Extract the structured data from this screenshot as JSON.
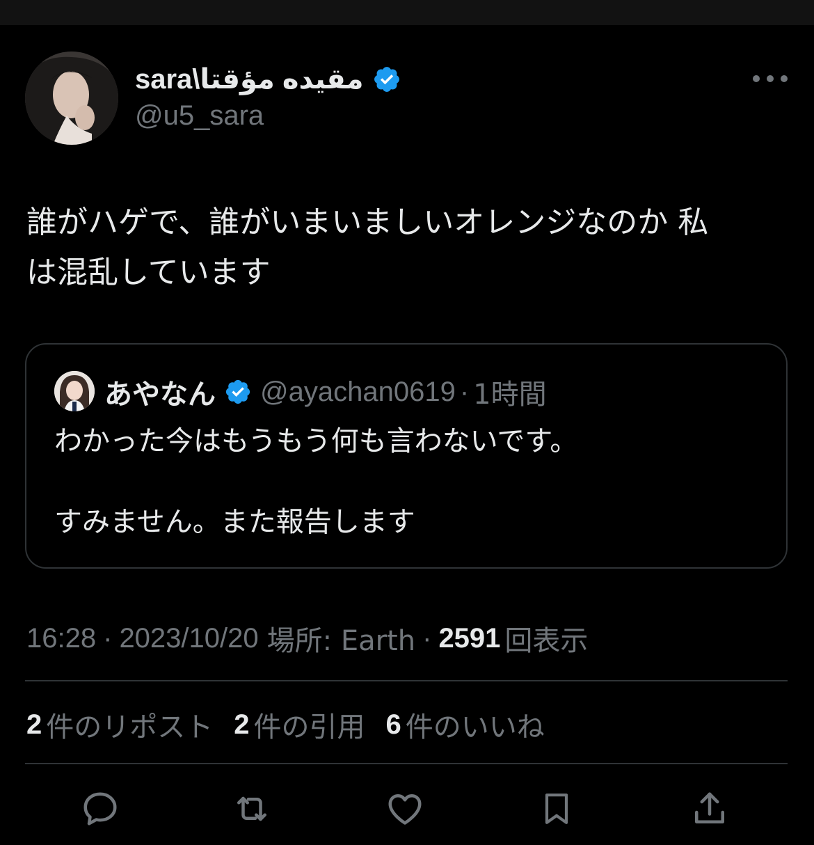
{
  "author": {
    "display_name": "sara\\مقيده مؤقتا",
    "handle": "@u5_sara",
    "verified": true,
    "verified_color": "#1d9bf0"
  },
  "tweet": {
    "text_line1": "誰がハゲで、誰がいまいましいオレンジなのか 私",
    "text_line2": "は混乱しています"
  },
  "quote": {
    "author_name": "あやなん",
    "handle": "@ayachan0619",
    "separator": "·",
    "time": "1時間",
    "text_line1": "わかった今はもうもう何も言わないです。",
    "text_line2": "すみません。また報告します"
  },
  "meta": {
    "time": "16:28",
    "date": "2023/10/20",
    "location": "場所: Earth",
    "views_count": "2591",
    "views_label": "回表示",
    "separator": "·"
  },
  "stats": [
    {
      "count": "2",
      "label": "件のリポスト"
    },
    {
      "count": "2",
      "label": "件の引用"
    },
    {
      "count": "6",
      "label": "件のいいね"
    }
  ],
  "actions": [
    "reply-icon",
    "repost-icon",
    "like-icon",
    "bookmark-icon",
    "share-icon"
  ],
  "colors": {
    "background": "#000000",
    "text": "#e7e9ea",
    "secondary": "#71767b",
    "border": "#2f3336"
  }
}
